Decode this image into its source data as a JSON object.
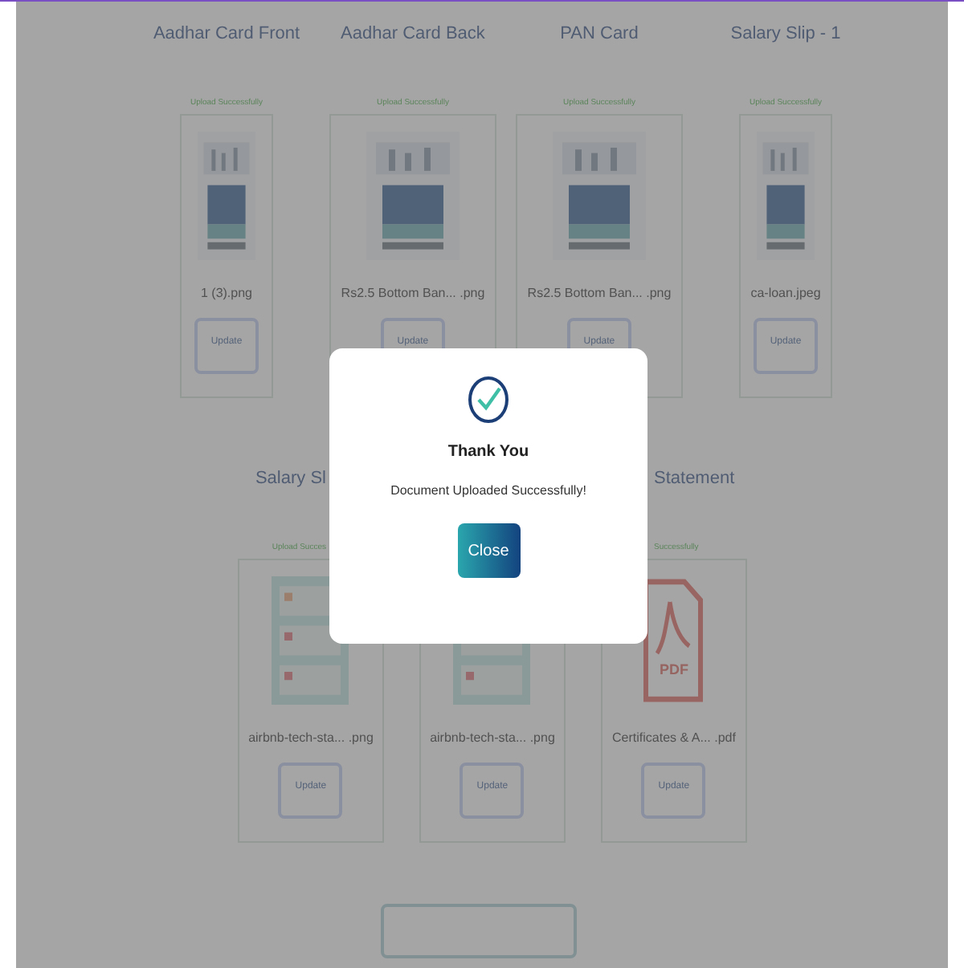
{
  "documents_top": [
    {
      "title": "Aadhar Card Front",
      "status": "Upload Successfully",
      "filename": "1 (3).png",
      "button": "Update"
    },
    {
      "title": "Aadhar Card Back",
      "status": "Upload Successfully",
      "filename": "Rs2.5 Bottom Ban... .png",
      "button": "Update"
    },
    {
      "title": "PAN Card",
      "status": "Upload Successfully",
      "filename": "Rs2.5 Bottom Ban... .png",
      "button": "Update"
    },
    {
      "title": "Salary Slip - 1",
      "status": "Upload Successfully",
      "filename": "ca-loan.jpeg",
      "button": "Update"
    }
  ],
  "documents_bottom": [
    {
      "title": "Salary Sl",
      "status": "Upload Succes",
      "kind": "sheet",
      "filename": "airbnb-tech-sta... .png",
      "button": "Update"
    },
    {
      "kind": "sheet",
      "filename": "airbnb-tech-sta... .png",
      "button": "Update"
    },
    {
      "title": "Statement",
      "status": "Successfully",
      "kind": "pdf",
      "pdf_label": "PDF",
      "filename": "Certificates & A... .pdf",
      "button": "Update"
    }
  ],
  "dialog": {
    "title": "Thank You",
    "message": "Document Uploaded Successfully!",
    "button": "Close"
  }
}
